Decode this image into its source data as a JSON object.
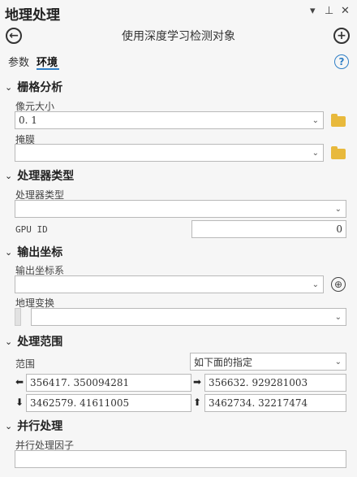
{
  "header": {
    "title": "地理处理",
    "tool_name": "使用深度学习检测对象",
    "back_icon": "back-arrow-icon",
    "add_icon": "add-circle-icon"
  },
  "tabs": [
    {
      "label": "参数",
      "active": false
    },
    {
      "label": "环境",
      "active": true
    }
  ],
  "sections": {
    "raster_analysis": {
      "title": "栅格分析",
      "cell_size_label": "像元大小",
      "cell_size_value": "0. 1",
      "mask_label": "掩膜",
      "mask_value": ""
    },
    "processor_type": {
      "title": "处理器类型",
      "processor_label": "处理器类型",
      "processor_value": "",
      "gpu_label": "GPU ID",
      "gpu_value": "0"
    },
    "output_coords": {
      "title": "输出坐标",
      "coord_system_label": "输出坐标系",
      "coord_system_value": "",
      "transform_label": "地理变换",
      "transform_value": ""
    },
    "processing_extent": {
      "title": "处理范围",
      "extent_label": "范围",
      "extent_value": "如下面的指定",
      "left": "356417. 350094281",
      "right": "356632. 929281003",
      "bottom": "3462579. 41611005",
      "top": "3462734. 32217474"
    },
    "parallel": {
      "title": "并行处理",
      "factor_label": "并行处理因子",
      "factor_value": ""
    }
  }
}
